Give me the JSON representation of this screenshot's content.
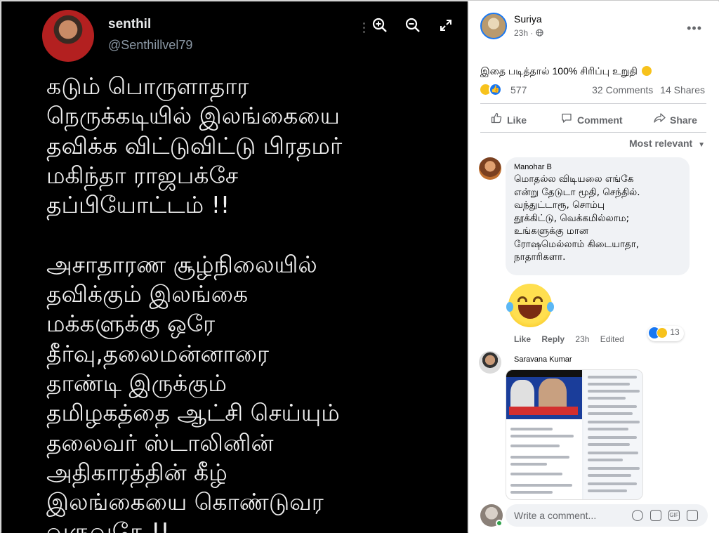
{
  "tweet": {
    "name": "senthil",
    "handle": "@Senthillvel79",
    "text": "கடும் பொருளாதார\nநெருக்கடியில் இலங்கையை\nதவிக்க விட்டுவிட்டு பிரதமர்\nமகிந்தா ராஜபக்சே\nதப்பியோட்டம் !!\n\nஅசாதாரண சூழ்நிலையில்\nதவிக்கும் இலங்கை\nமக்களுக்கு ஒரே\nதீர்வு,தலைமன்னாரை\nதாண்டி இருக்கும்\nதமிழகத்தை ஆட்சி செய்யும்\nதலைவர் ஸ்டாலினின்\nஅதிகாரத்தின் கீழ்\nஇலங்கையை கொண்டுவர\nவருவதே !!"
  },
  "viewer_tools": {
    "zoom_in": "⊕",
    "zoom_out": "⊖",
    "fullscreen": "⤢",
    "icons": [
      "zoom-in-icon",
      "zoom-out-icon",
      "fullscreen-icon"
    ]
  },
  "post": {
    "author": "Suriya",
    "time": "23h ·",
    "privacy_icon": "globe-icon",
    "text": "இதை படித்தால் 100% சிரிப்பு உறுதி",
    "reaction_count": "577",
    "comments": "32 Comments",
    "shares": "14 Shares"
  },
  "actions": {
    "like": "Like",
    "comment": "Comment",
    "share": "Share"
  },
  "sort_label": "Most relevant",
  "comments": [
    {
      "name": "Manohar B",
      "text": "மொதல்ல விடியலை எங்கே\nஎன்று தேடுடா மூதி, செந்தில்.\nவந்துட்டாரூ, சொம்பு\nதூக்கிட்டு, வெக்கமில்லாம;\nஉங்களுக்கு மான\nரோஷமெல்லாம் கிடையாதா,\nநாதாரிகளா.",
      "like": "Like",
      "reply": "Reply",
      "time": "23h",
      "edited": "Edited",
      "reaction_count": "13"
    },
    {
      "name": "Saravana Kumar"
    }
  ],
  "composer": {
    "placeholder": "Write a comment..."
  },
  "colors": {
    "accent": "#1877f2",
    "photo_bg": "#000000",
    "bubble": "#f0f2f5"
  }
}
